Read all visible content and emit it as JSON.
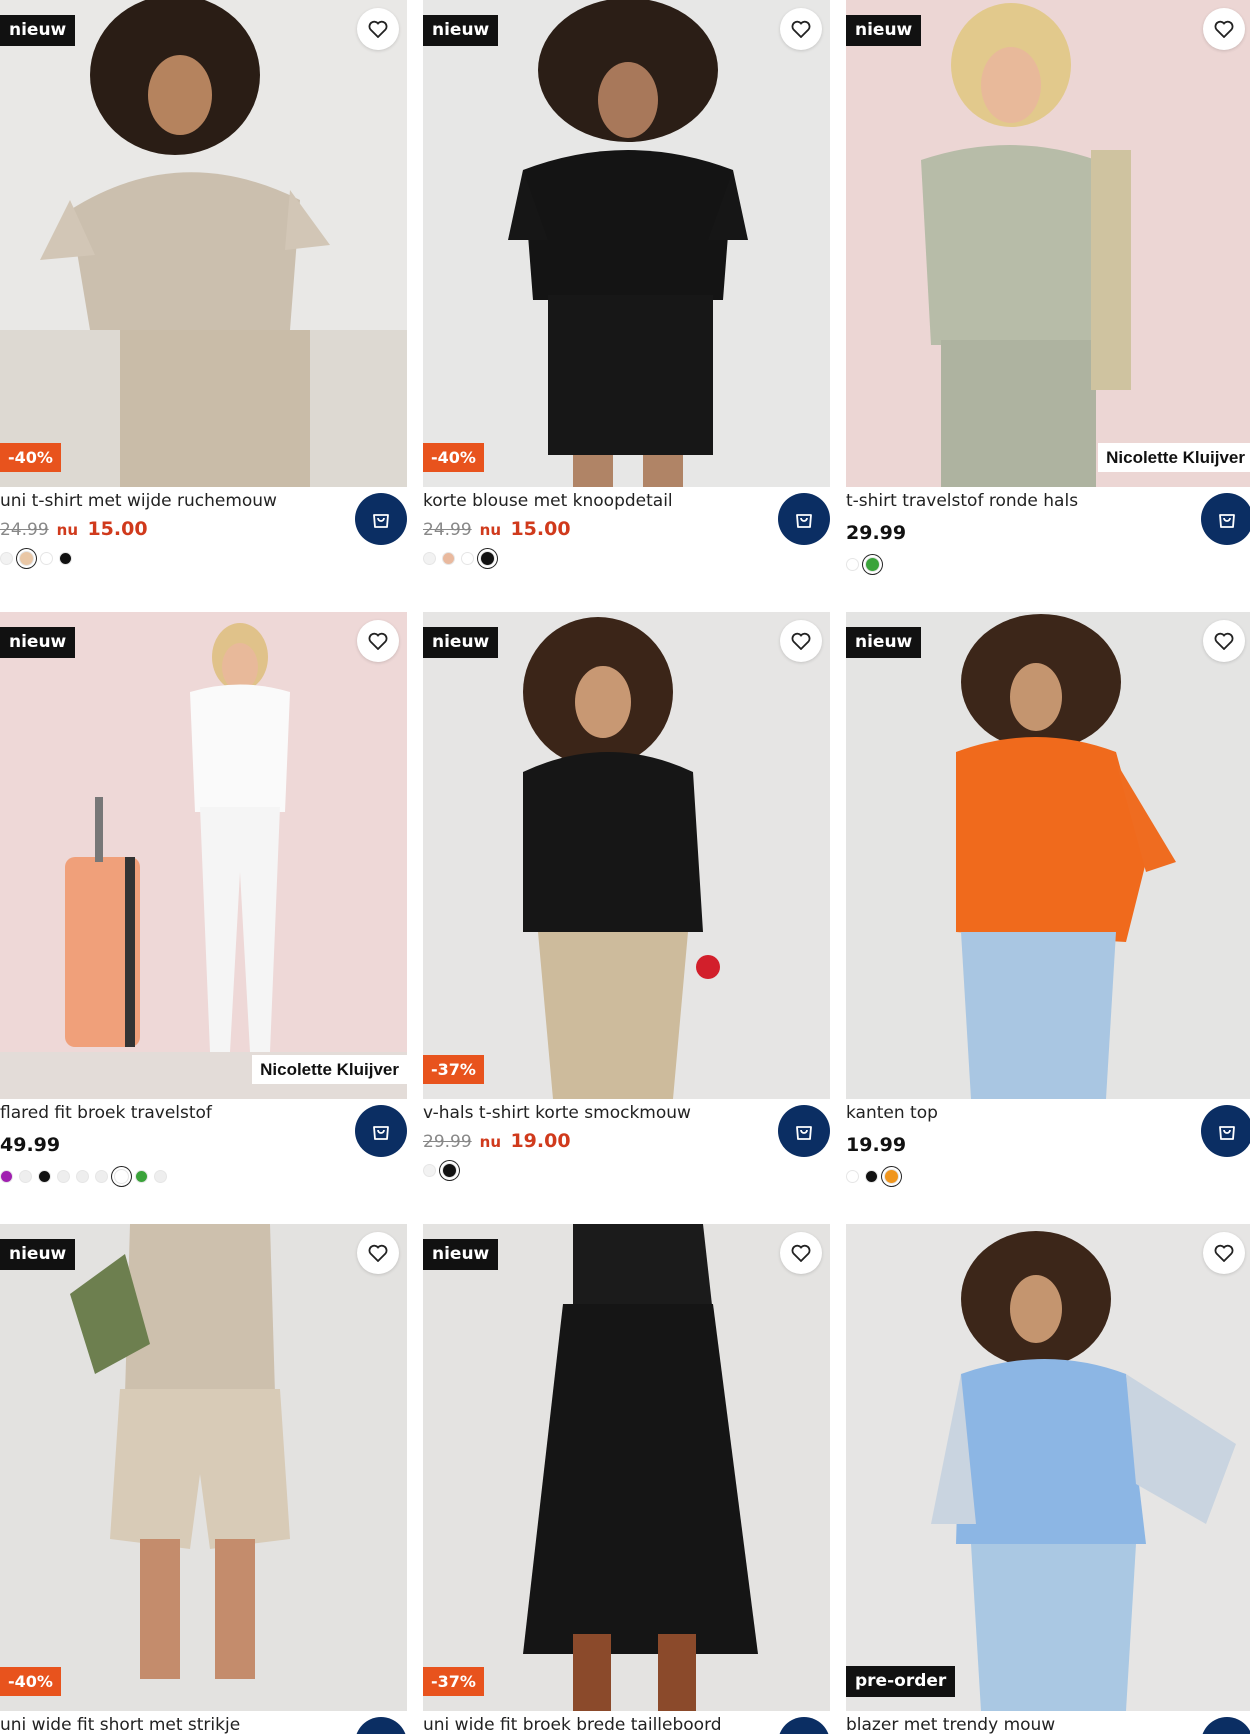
{
  "labels": {
    "new_badge": "nieuw",
    "now_prefix": "nu",
    "preorder_badge": "pre-order"
  },
  "colors": {
    "cart_button": "#0b2e63",
    "discount_badge": "#e8531d",
    "sale_price": "#d03a1c",
    "badge_dark": "#111111"
  },
  "products": [
    {
      "title": "uni t-shirt met wijde ruchemouw",
      "old_price": "24.99",
      "price": "15.00",
      "discount": "-40%",
      "swatches": [
        "#f2f2f2",
        "#e9c7a6",
        "#ffffff",
        "#111111"
      ],
      "selected_swatch": 1
    },
    {
      "title": "korte blouse met knoopdetail",
      "old_price": "24.99",
      "price": "15.00",
      "discount": "-40%",
      "swatches": [
        "#f2f2f2",
        "#e9b99e",
        "#ffffff",
        "#111111"
      ],
      "selected_swatch": 3
    },
    {
      "title": "t-shirt travelstof ronde hals",
      "price": "29.99",
      "brand": "Nicolette Kluijver",
      "swatches": [
        "#ffffff",
        "#3aa33a"
      ],
      "selected_swatch": 1
    },
    {
      "title": "flared fit broek travelstof",
      "price": "49.99",
      "brand": "Nicolette Kluijver",
      "swatches": [
        "#a01fb0",
        "#eeeeee",
        "#111111",
        "#eeeeee",
        "#eeeeee",
        "#eeeeee",
        "#ffffff",
        "#3aa33a",
        "#eeeeee"
      ],
      "selected_swatch": 6
    },
    {
      "title": "v-hals t-shirt korte smockmouw",
      "old_price": "29.99",
      "price": "19.00",
      "discount": "-37%",
      "swatches": [
        "#f2f2f2",
        "#111111"
      ],
      "selected_swatch": 1
    },
    {
      "title": "kanten top",
      "price": "19.99",
      "swatches": [
        "#ffffff",
        "#111111",
        "#f0961e"
      ],
      "selected_swatch": 2
    },
    {
      "title": "uni wide fit short met strikje",
      "discount": "-40%"
    },
    {
      "title": "uni wide fit broek brede tailleboord",
      "discount": "-37%"
    },
    {
      "title": "blazer met trendy mouw",
      "preorder": true
    }
  ]
}
